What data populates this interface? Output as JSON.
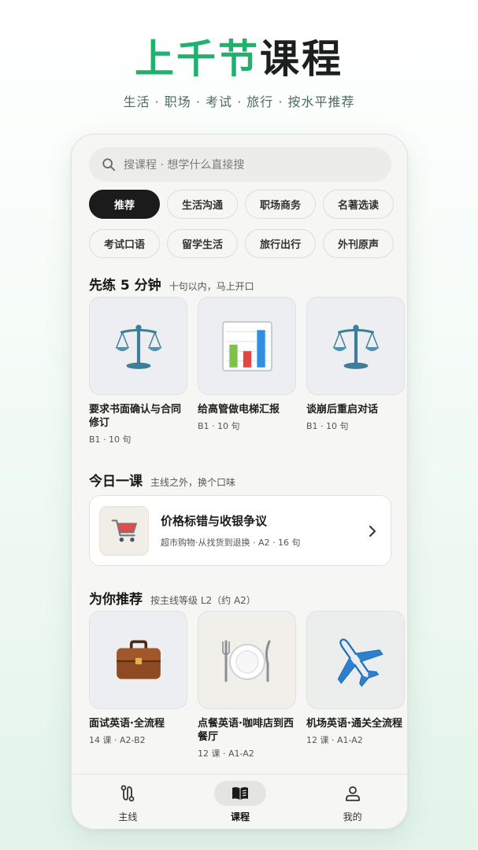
{
  "hero": {
    "title_green": "上千节",
    "title_dark": "课程",
    "subtitle": "生活 · 职场 · 考试 · 旅行 · 按水平推荐"
  },
  "search": {
    "placeholder": "搜课程 · 想学什么直接搜",
    "icon": "search-icon"
  },
  "chips": [
    [
      {
        "label": "推荐",
        "active": true
      },
      {
        "label": "生活沟通"
      },
      {
        "label": "职场商务"
      },
      {
        "label": "名著选读"
      }
    ],
    [
      {
        "label": "考试口语"
      },
      {
        "label": "留学生活"
      },
      {
        "label": "旅行出行"
      },
      {
        "label": "外刊原声"
      }
    ]
  ],
  "practice": {
    "title": "先练 5 分钟",
    "subtitle": "十句以内，马上开口",
    "cards": [
      {
        "title": "要求书面确认与合同修订",
        "meta": "B1 · 10 句",
        "icon": "balance-scale-icon"
      },
      {
        "title": "给高管做电梯汇报",
        "meta": "B1 · 10 句",
        "icon": "bar-chart-icon"
      },
      {
        "title": "谈崩后重启对话",
        "meta": "B1 · 10 句",
        "icon": "balance-scale-icon"
      }
    ]
  },
  "today": {
    "title": "今日一课",
    "subtitle": "主线之外，换个口味",
    "lesson": {
      "title": "价格标错与收银争议",
      "meta": "超市购物·从找货到退换 · A2 · 16 句",
      "icon": "shopping-cart-icon"
    }
  },
  "recommend": {
    "title": "为你推荐",
    "subtitle": "按主线等级 L2（约 A2）",
    "cards": [
      {
        "title": "面试英语·全流程",
        "meta": "14 课 · A2-B2",
        "icon": "briefcase-icon"
      },
      {
        "title": "点餐英语·咖啡店到西餐厅",
        "meta": "12 课 · A1-A2",
        "icon": "dining-plate-icon"
      },
      {
        "title": "机场英语·通关全流程",
        "meta": "12 课 · A1-A2",
        "icon": "airplane-icon"
      }
    ]
  },
  "tabbar": [
    {
      "label": "主线",
      "icon": "route-icon",
      "active": false
    },
    {
      "label": "课程",
      "icon": "open-book-icon",
      "active": true
    },
    {
      "label": "我的",
      "icon": "person-icon",
      "active": false
    }
  ],
  "colors": {
    "brand_green": "#1fb26e",
    "chip_active": "#1b1b1b"
  }
}
